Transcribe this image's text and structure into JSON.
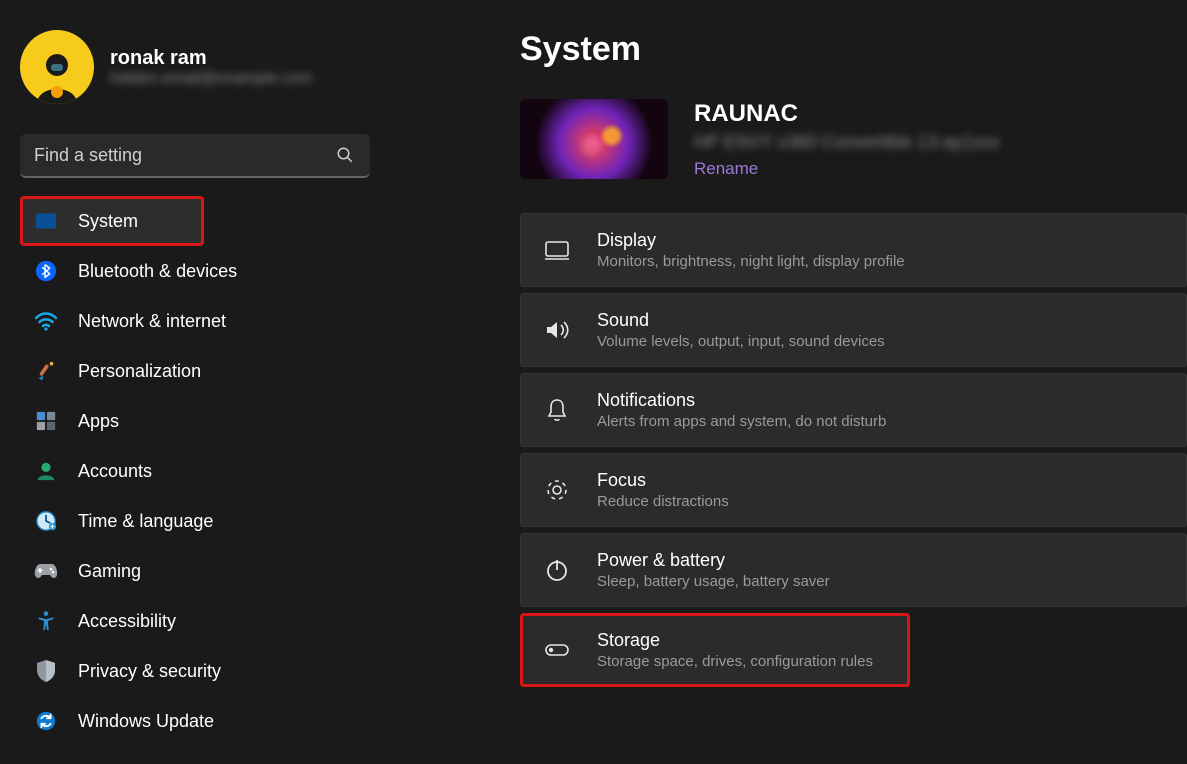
{
  "user": {
    "name": "ronak ram",
    "email": "hidden.email@example.com"
  },
  "search": {
    "placeholder": "Find a setting"
  },
  "sidebar": {
    "items": [
      {
        "label": "System",
        "icon": "system-icon",
        "selected": true
      },
      {
        "label": "Bluetooth & devices",
        "icon": "bluetooth-icon",
        "selected": false
      },
      {
        "label": "Network & internet",
        "icon": "wifi-icon",
        "selected": false
      },
      {
        "label": "Personalization",
        "icon": "paintbrush-icon",
        "selected": false
      },
      {
        "label": "Apps",
        "icon": "apps-icon",
        "selected": false
      },
      {
        "label": "Accounts",
        "icon": "accounts-icon",
        "selected": false
      },
      {
        "label": "Time & language",
        "icon": "clock-icon",
        "selected": false
      },
      {
        "label": "Gaming",
        "icon": "gaming-icon",
        "selected": false
      },
      {
        "label": "Accessibility",
        "icon": "accessibility-icon",
        "selected": false
      },
      {
        "label": "Privacy & security",
        "icon": "shield-icon",
        "selected": false
      },
      {
        "label": "Windows Update",
        "icon": "update-icon",
        "selected": false
      }
    ]
  },
  "page": {
    "title": "System",
    "device": {
      "name": "RAUNAC",
      "model": "HP ENVY x360 Convertible 13-ay1xxx",
      "rename_label": "Rename"
    },
    "cards": [
      {
        "title": "Display",
        "desc": "Monitors, brightness, night light, display profile",
        "icon": "display-icon",
        "highlight": false
      },
      {
        "title": "Sound",
        "desc": "Volume levels, output, input, sound devices",
        "icon": "sound-icon",
        "highlight": false
      },
      {
        "title": "Notifications",
        "desc": "Alerts from apps and system, do not disturb",
        "icon": "notification-icon",
        "highlight": false
      },
      {
        "title": "Focus",
        "desc": "Reduce distractions",
        "icon": "focus-icon",
        "highlight": false
      },
      {
        "title": "Power & battery",
        "desc": "Sleep, battery usage, battery saver",
        "icon": "power-icon",
        "highlight": false
      },
      {
        "title": "Storage",
        "desc": "Storage space, drives, configuration rules",
        "icon": "storage-icon",
        "highlight": true
      }
    ]
  }
}
